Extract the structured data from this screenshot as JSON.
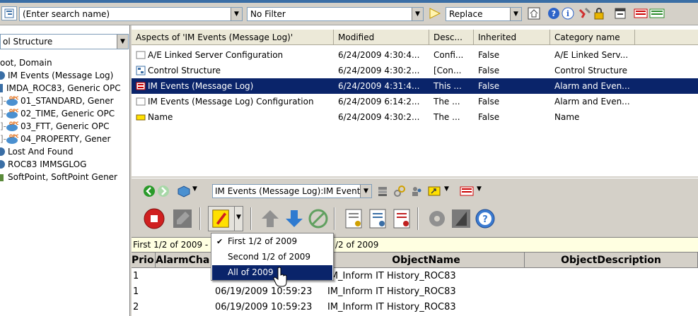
{
  "toolbar": {
    "search_placeholder": "(Enter search name)",
    "filter_value": "No Filter",
    "mode_value": "Replace"
  },
  "tree_panel": {
    "structure_combo": "ol Structure",
    "items": [
      {
        "label": "oot, Domain"
      },
      {
        "label": "IM Events (Message Log)"
      },
      {
        "label": "IMDA_ROC83, Generic OPC"
      },
      {
        "label": "01_STANDARD, Gener"
      },
      {
        "label": "02_TIME, Generic OPC"
      },
      {
        "label": "03_FTT, Generic OPC"
      },
      {
        "label": "04_PROPERTY, Gener"
      },
      {
        "label": "Lost And Found"
      },
      {
        "label": "ROC83 IMMSGLOG"
      },
      {
        "label": "SoftPoint, SoftPoint Gener"
      }
    ]
  },
  "aspects_table": {
    "headers": [
      "Aspects of 'IM Events (Message Log)'",
      "Modified",
      "Desc...",
      "Inherited",
      "Category name"
    ],
    "rows": [
      {
        "name": "A/E Linked Server Configuration",
        "modified": "6/24/2009 4:30:4...",
        "desc": "Confi...",
        "inherited": "False",
        "category": "A/E Linked Serv..."
      },
      {
        "name": "Control Structure",
        "modified": "6/24/2009 4:30:2...",
        "desc": "[Con...",
        "inherited": "False",
        "category": "Control Structure"
      },
      {
        "name": "IM Events (Message Log)",
        "modified": "6/24/2009 4:31:4...",
        "desc": "This ...",
        "inherited": "False",
        "category": "Alarm and Even..."
      },
      {
        "name": "IM Events (Message Log) Configuration",
        "modified": "6/24/2009 6:14:2...",
        "desc": "The ...",
        "inherited": "False",
        "category": "Alarm and Even..."
      },
      {
        "name": "Name",
        "modified": "6/24/2009 4:30:2...",
        "desc": "The ...",
        "inherited": "False",
        "category": "Name"
      }
    ],
    "selected_index": 2
  },
  "nav_bar": {
    "path": "IM Events (Message Log):IM Events"
  },
  "filter_bar": {
    "text_left": "First 1/2 of 2009 -",
    "text_right": "/2 of 2009"
  },
  "events_grid": {
    "headers": [
      "Prio",
      "AlarmCha",
      "",
      "ObjectName",
      "ObjectDescription"
    ],
    "rows": [
      {
        "prio": "1",
        "time": "",
        "object": "IM_Inform IT History_ROC83"
      },
      {
        "prio": "1",
        "time": "06/19/2009 10:59:23",
        "object": "IM_Inform IT History_ROC83"
      },
      {
        "prio": "2",
        "time": "06/19/2009 10:59:23",
        "object": "IM_Inform IT History_ROC83"
      }
    ]
  },
  "period_menu": {
    "items": [
      {
        "label": "First 1/2 of 2009",
        "checked": true
      },
      {
        "label": "Second 1/2 of 2009",
        "checked": false
      },
      {
        "label": "All of 2009",
        "checked": false
      }
    ],
    "highlighted_index": 2
  },
  "colors": {
    "selection": "#0a246a",
    "window_bg": "#d4d0c8",
    "info_bar": "#ffffe1"
  }
}
